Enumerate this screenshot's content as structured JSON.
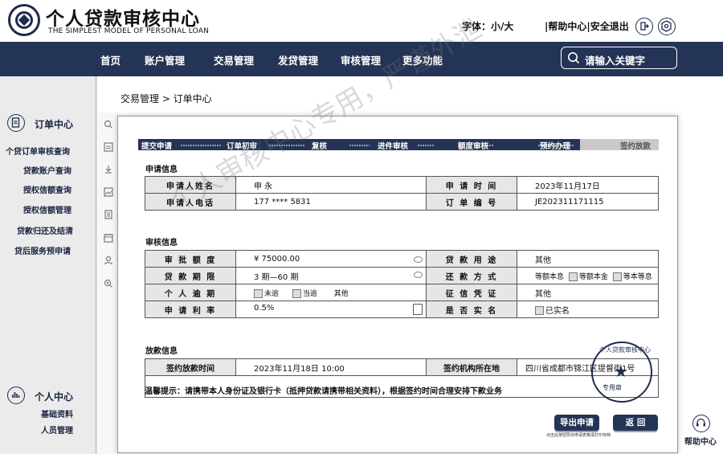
{
  "header": {
    "title": "个人贷款审核中心",
    "subtitle": "THE SIMPLEST MODEL OF PERSONAL LOAN",
    "font_label": "字体：小/大",
    "help_links": "|帮助中心|安全退出"
  },
  "nav": {
    "items": [
      "首页",
      "账户管理",
      "交易管理",
      "发贷管理",
      "审核管理",
      "更多功能"
    ],
    "search_placeholder": "请输入关键字"
  },
  "sidebar": {
    "group1_title": "订单中心",
    "items": [
      "个贷订单审核查询",
      "贷款账户查询",
      "授权信额查询",
      "授权信额管理",
      "贷款归还及结清",
      "贷后服务预申请"
    ],
    "group2_title": "个人中心",
    "group2_items": [
      "基础资料",
      "人员管理"
    ]
  },
  "breadcrumb": "交易管理 > 订单中心",
  "progress": {
    "steps": [
      "提交申请",
      "订单初审",
      "复核",
      "进件审核",
      "额度审核",
      "预约办理",
      "签约放款"
    ],
    "current_step": "预约办理"
  },
  "sections": {
    "application": "申请信息",
    "review": "审核信息",
    "disbursement": "放款信息"
  },
  "application": {
    "name_label": "申请人姓名",
    "name_value": "申  永",
    "time_label": "申 请 时 间",
    "time_value": "2023年11月17日",
    "phone_label": "申请人电话",
    "phone_value": "177  ****  5831",
    "order_label": "订 单 编 号",
    "order_value": "JE202311171115"
  },
  "review": {
    "amount_label": "审 批 额 度",
    "amount_value": "¥ 75000.00",
    "purpose_label": "贷 款 用 途",
    "purpose_value": "其他",
    "term_label": "贷 款 期 限",
    "term_value": "3  期—60  期",
    "repay_label": "还 款 方 式",
    "repay_options": [
      "等额本息",
      "等额本金",
      "等本等息"
    ],
    "overdue_label": "个 人 逾 期",
    "overdue_options": [
      "未逾",
      "当逾",
      "其他"
    ],
    "credit_label": "征 信 凭 证",
    "credit_value": "其他",
    "rate_label": "申 请 利 率",
    "rate_value": "0.5%",
    "realname_label": "是 否 实 名",
    "realname_value": "已实名"
  },
  "disbursement": {
    "time_label": "签约放款时间",
    "time_value": "2023年11月18日  10:00",
    "location_label": "签约机构所在地",
    "location_value": "四川省成都市锦江区提督街1号",
    "hint": "温馨提示：请携带本人身份证及银行卡（抵押贷款请携带相关资料），根据签约时间合理安排下款业务"
  },
  "buttons": {
    "export": "导出申请",
    "back": "返 回",
    "export_note": "点击此按钮导出申请表格请打印存档"
  },
  "stamp": {
    "text": "个人贷款审核中心",
    "bottom": "专用章"
  },
  "watermark": "个人审核中心专用，严谨外泄",
  "help_center": "帮助中心"
}
